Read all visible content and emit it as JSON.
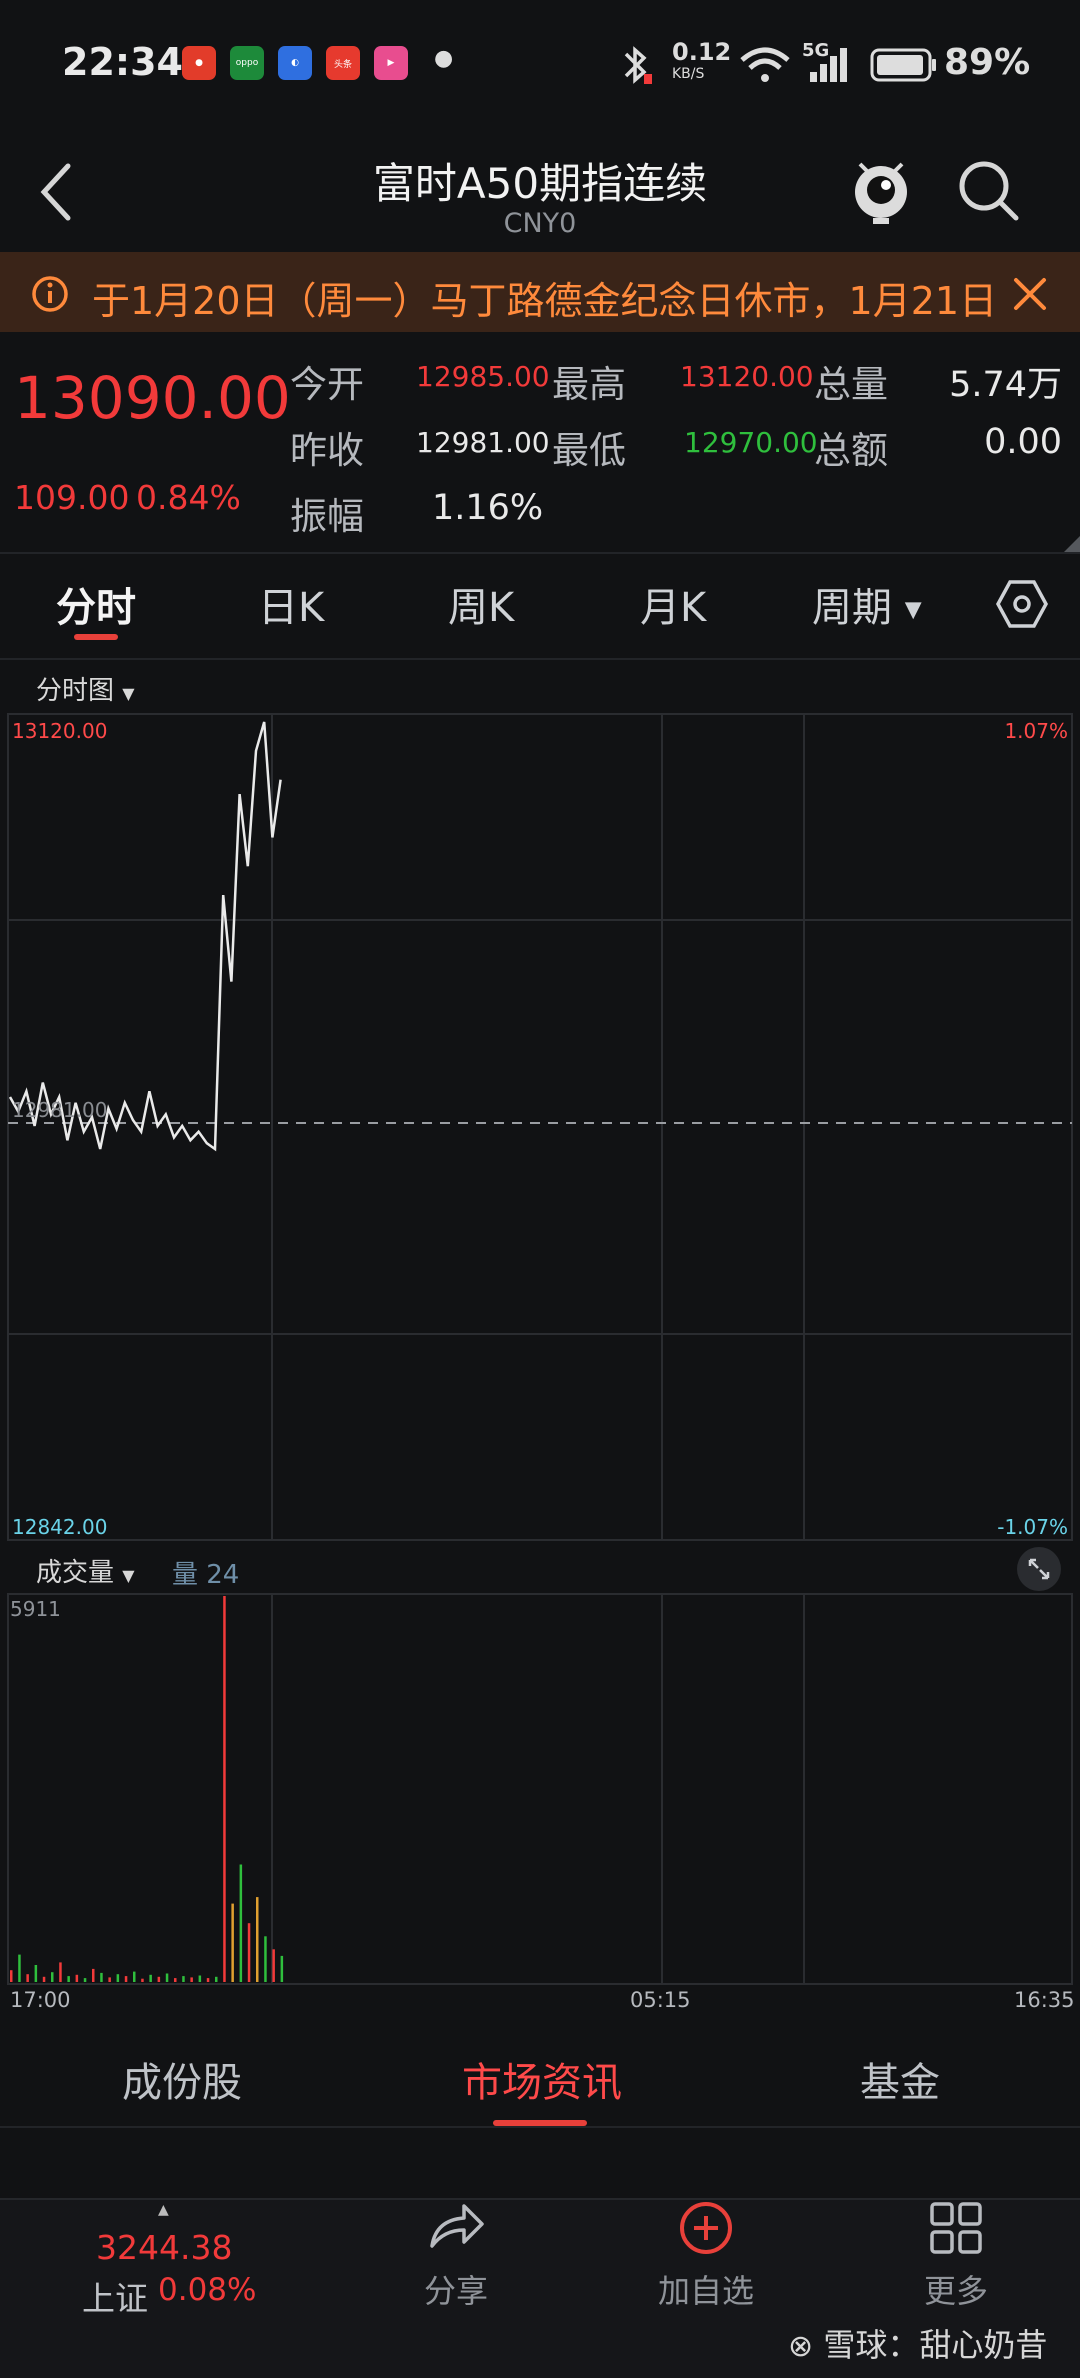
{
  "status_bar": {
    "time": "22:34",
    "app_icons": [
      "weibo-app-icon",
      "oppo-app-icon",
      "news-app-icon",
      "toutiao-app-icon",
      "video-app-icon"
    ],
    "net_speed_value": "0.12",
    "net_speed_unit": "KB/S",
    "network": "5G",
    "battery": "89%"
  },
  "header": {
    "title": "富时A50期指连续",
    "code": "CNY0"
  },
  "notice": {
    "text": "于1月20日（周一）马丁路德金纪念日休市，1月21日"
  },
  "quote": {
    "price": "13090.00",
    "change": "109.00",
    "change_pct": "0.84%",
    "open_label": "今开",
    "open": "12985.00",
    "high_label": "最高",
    "high": "13120.00",
    "volume_label": "总量",
    "volume": "5.74万",
    "prev_close_label": "昨收",
    "prev_close": "12981.00",
    "low_label": "最低",
    "low": "12970.00",
    "amount_label": "总额",
    "amount": "0.00",
    "amplitude_label": "振幅",
    "amplitude": "1.16%"
  },
  "tabs": {
    "items": [
      "分时",
      "日K",
      "周K",
      "月K",
      "周期"
    ],
    "active": "分时"
  },
  "chart_data": {
    "type": "line",
    "selector_label": "分时图",
    "y_max_label": "13120.00",
    "y_min_label": "12842.00",
    "pct_max_label": "1.07%",
    "pct_min_label": "-1.07%",
    "ref_label": "12981.00",
    "ylim": [
      12842,
      13120
    ],
    "reference_line": 12981,
    "x_labels": [
      "17:00",
      "05:15",
      "16:35"
    ],
    "series": [
      {
        "values": [
          12990,
          12985,
          12992,
          12980,
          12995,
          12984,
          12990,
          12975,
          12988,
          12978,
          12983,
          12972,
          12986,
          12979,
          12988,
          12982,
          12978,
          12992,
          12980,
          12984,
          12976,
          12980,
          12975,
          12978,
          12974,
          12972,
          13060,
          13030,
          13095,
          13070,
          13110,
          13120,
          13080,
          13100
        ]
      }
    ],
    "volume": {
      "selector_label": "成交量",
      "indicator_label": "量 24",
      "max_label": "5911",
      "ymax": 5911,
      "bars": [
        180,
        420,
        120,
        260,
        80,
        150,
        300,
        90,
        110,
        60,
        200,
        140,
        70,
        120,
        90,
        160,
        50,
        110,
        80,
        130,
        60,
        90,
        70,
        100,
        60,
        80,
        5911,
        1200,
        1800,
        900,
        1300,
        700,
        500,
        400
      ],
      "bar_colors": [
        "#f23a3a",
        "#2fbf3d",
        "#f23a3a",
        "#2fbf3d",
        "#f23a3a",
        "#2fbf3d",
        "#f23a3a",
        "#2fbf3d",
        "#f23a3a",
        "#2fbf3d",
        "#f23a3a",
        "#2fbf3d",
        "#f23a3a",
        "#2fbf3d",
        "#f23a3a",
        "#2fbf3d",
        "#f23a3a",
        "#2fbf3d",
        "#f23a3a",
        "#2fbf3d",
        "#f23a3a",
        "#2fbf3d",
        "#f23a3a",
        "#2fbf3d",
        "#f23a3a",
        "#2fbf3d",
        "#f23a3a",
        "#e0a030",
        "#2fbf3d",
        "#f23a3a",
        "#e0a030",
        "#2fbf3d",
        "#f23a3a",
        "#2fbf3d"
      ]
    }
  },
  "sections": {
    "items": [
      "成份股",
      "市场资讯",
      "基金"
    ],
    "active": "市场资讯"
  },
  "bottom_nav": {
    "index_value": "3244.38",
    "index_name": "上证",
    "index_change": "0.08%",
    "share": "分享",
    "add": "加自选",
    "more": "更多"
  },
  "watermark": "雪球：甜心奶昔",
  "colors": {
    "up": "#f23a3a",
    "down": "#2fbf3d",
    "accent": "#e8403a",
    "notice_bg": "#3a2418",
    "notice_text": "#ff8a3c"
  }
}
